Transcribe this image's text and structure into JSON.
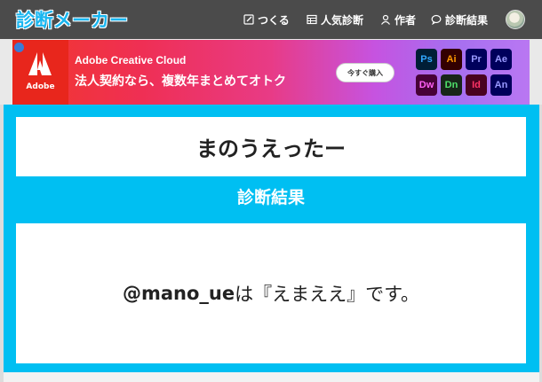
{
  "header": {
    "logo": "診断メーカー",
    "nav": {
      "make": "つくる",
      "popular": "人気診断",
      "author": "作者",
      "results": "診断結果"
    }
  },
  "ad": {
    "brand": "Adobe",
    "title": "Adobe Creative Cloud",
    "tagline": "法人契約なら、複数年まとめてオトク",
    "cta": "今すぐ購入",
    "apps": [
      "Ps",
      "Ai",
      "Pr",
      "Ae",
      "Dw",
      "Dn",
      "Id",
      "An"
    ]
  },
  "main": {
    "diagnosis_title": "まのうえったー",
    "section_label": "診断結果",
    "result_user": "@mano_ue",
    "result_text": "は『えまええ』です。"
  },
  "colors": {
    "header_bg": "#4b4b4b",
    "accent": "#00bff2",
    "logo": "#19b6f0"
  }
}
